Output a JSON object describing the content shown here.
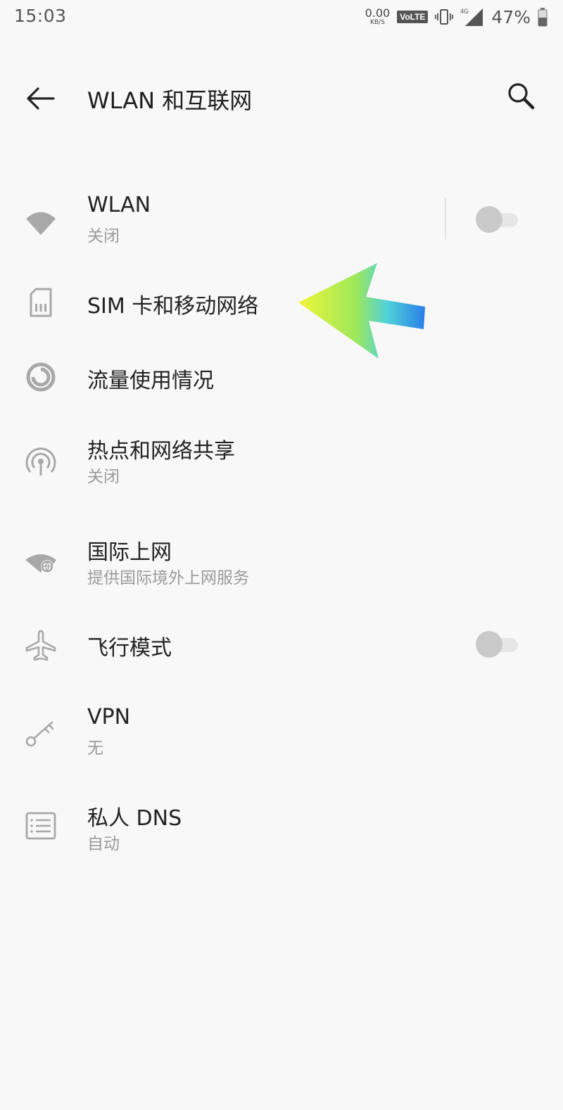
{
  "status_bar": {
    "time": "15:03",
    "net_speed_value": "0.00",
    "net_speed_unit": "KB/S",
    "volte": "VoLTE",
    "network_type": "4G",
    "battery_percent": "47%"
  },
  "header": {
    "title": "WLAN 和互联网"
  },
  "settings": [
    {
      "title": "WLAN",
      "subtitle": "关闭",
      "icon": "wifi-icon",
      "toggle": false
    },
    {
      "title": "SIM 卡和移动网络",
      "subtitle": "",
      "icon": "sim-card-icon"
    },
    {
      "title": "流量使用情况",
      "subtitle": "",
      "icon": "data-usage-icon"
    },
    {
      "title": "热点和网络共享",
      "subtitle": "关闭",
      "icon": "hotspot-icon"
    },
    {
      "title": "国际上网",
      "subtitle": "提供国际境外上网服务",
      "icon": "global-roaming-icon"
    },
    {
      "title": "飞行模式",
      "subtitle": "",
      "icon": "airplane-icon",
      "toggle": false
    },
    {
      "title": "VPN",
      "subtitle": "无",
      "icon": "vpn-key-icon"
    },
    {
      "title": "私人 DNS",
      "subtitle": "自动",
      "icon": "private-dns-icon"
    }
  ],
  "colors": {
    "background": "#f8f8f8",
    "icon_gray": "#a8a8a8",
    "annotation_arrow_start": "#e8f33a",
    "annotation_arrow_end": "#2a7fe8"
  }
}
